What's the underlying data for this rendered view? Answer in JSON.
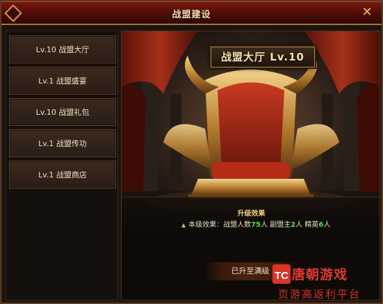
{
  "window": {
    "title": "战盟建设",
    "close_symbol": "✕"
  },
  "sidebar": {
    "items": [
      {
        "label": "Lv.10 战盟大厅"
      },
      {
        "label": "Lv.1 战盟盛宴"
      },
      {
        "label": "Lv.10 战盟礼包"
      },
      {
        "label": "Lv.1 战盟传功"
      },
      {
        "label": "Lv.1 战盟商店"
      }
    ]
  },
  "main": {
    "banner": "战盟大厅  Lv.10",
    "upgrade_title": "升级效果",
    "effect": {
      "prefix": "本级效果：战盟人数",
      "members": "75",
      "members_unit": "人 副盟主",
      "vice_leaders": "2",
      "vice_unit": "人 精英",
      "elites": "6",
      "elites_unit": "人"
    },
    "status_label": "已升至满级"
  },
  "watermark": {
    "logo": "TC",
    "line1": "唐朝游戏",
    "line2": "页游高返利平台"
  },
  "colors": {
    "accent": "#f0c050",
    "highlight_number": "#4fe04a",
    "title_bar": "#5a100a"
  }
}
